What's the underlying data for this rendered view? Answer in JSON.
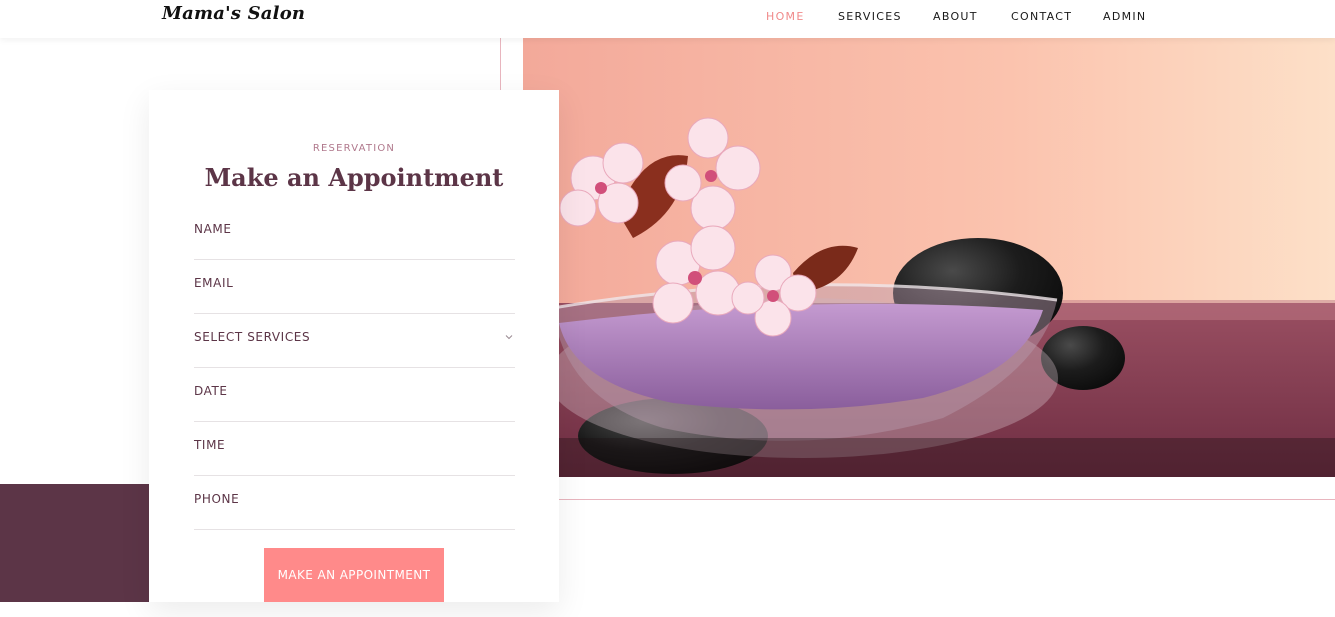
{
  "header": {
    "logo": "Mama's Salon",
    "nav": [
      "HOME",
      "SERVICES",
      "ABOUT",
      "CONTACT",
      "ADMIN"
    ],
    "active": "HOME"
  },
  "form": {
    "eyebrow": "RESERVATION",
    "title": "Make an Appointment",
    "fields": {
      "name": "NAME",
      "email": "EMAIL",
      "services": "SELECT SERVICES",
      "date": "DATE",
      "time": "TIME",
      "phone": "PHONE"
    },
    "submit": "MAKE AN APPOINTMENT"
  },
  "colors": {
    "accent": "#ff8a8a",
    "brand": "#5c3547",
    "active_nav": "#f08a8a"
  },
  "icons": {
    "select_arrow": "chevron-down-icon"
  }
}
